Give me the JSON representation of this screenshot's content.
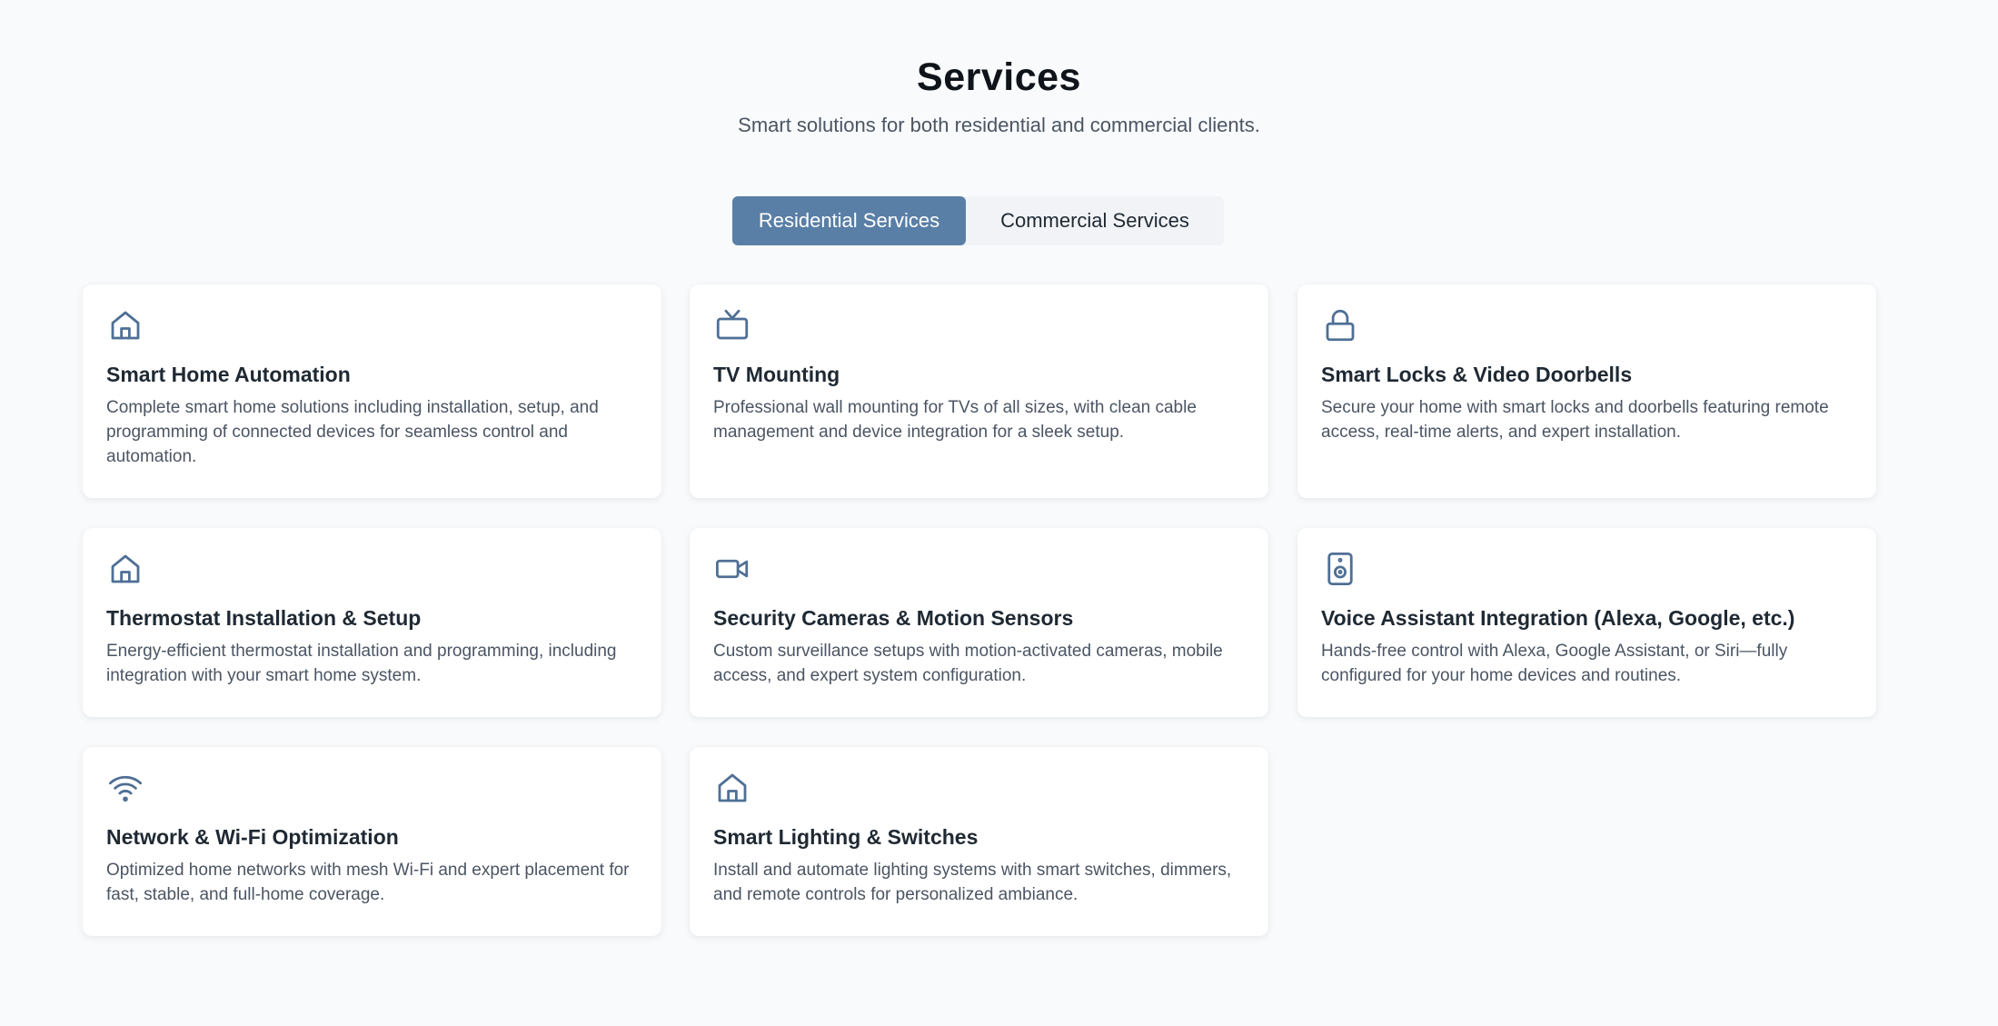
{
  "header": {
    "title": "Services",
    "subtitle": "Smart solutions for both residential and commercial clients."
  },
  "tabs": [
    {
      "label": "Residential Services",
      "active": true
    },
    {
      "label": "Commercial Services",
      "active": false
    }
  ],
  "colors": {
    "accent": "#5a7fa6",
    "icon": "#4f6f95",
    "background": "#f8fafc"
  },
  "services": [
    {
      "icon": "home-icon",
      "title": "Smart Home Automation",
      "description": "Complete smart home solutions including installation, setup, and programming of connected devices for seamless control and automation."
    },
    {
      "icon": "tv-icon",
      "title": "TV Mounting",
      "description": "Professional wall mounting for TVs of all sizes, with clean cable management and device integration for a sleek setup."
    },
    {
      "icon": "lock-icon",
      "title": "Smart Locks & Video Doorbells",
      "description": "Secure your home with smart locks and doorbells featuring remote access, real-time alerts, and expert installation."
    },
    {
      "icon": "home-icon",
      "title": "Thermostat Installation & Setup",
      "description": "Energy-efficient thermostat installation and programming, including integration with your smart home system."
    },
    {
      "icon": "video-camera-icon",
      "title": "Security Cameras & Motion Sensors",
      "description": "Custom surveillance setups with motion-activated cameras, mobile access, and expert system configuration."
    },
    {
      "icon": "speaker-icon",
      "title": "Voice Assistant Integration (Alexa, Google, etc.)",
      "description": "Hands-free control with Alexa, Google Assistant, or Siri—fully configured for your home devices and routines."
    },
    {
      "icon": "wifi-icon",
      "title": "Network & Wi-Fi Optimization",
      "description": "Optimized home networks with mesh Wi-Fi and expert placement for fast, stable, and full-home coverage."
    },
    {
      "icon": "home-icon",
      "title": "Smart Lighting & Switches",
      "description": "Install and automate lighting systems with smart switches, dimmers, and remote controls for personalized ambiance."
    }
  ]
}
